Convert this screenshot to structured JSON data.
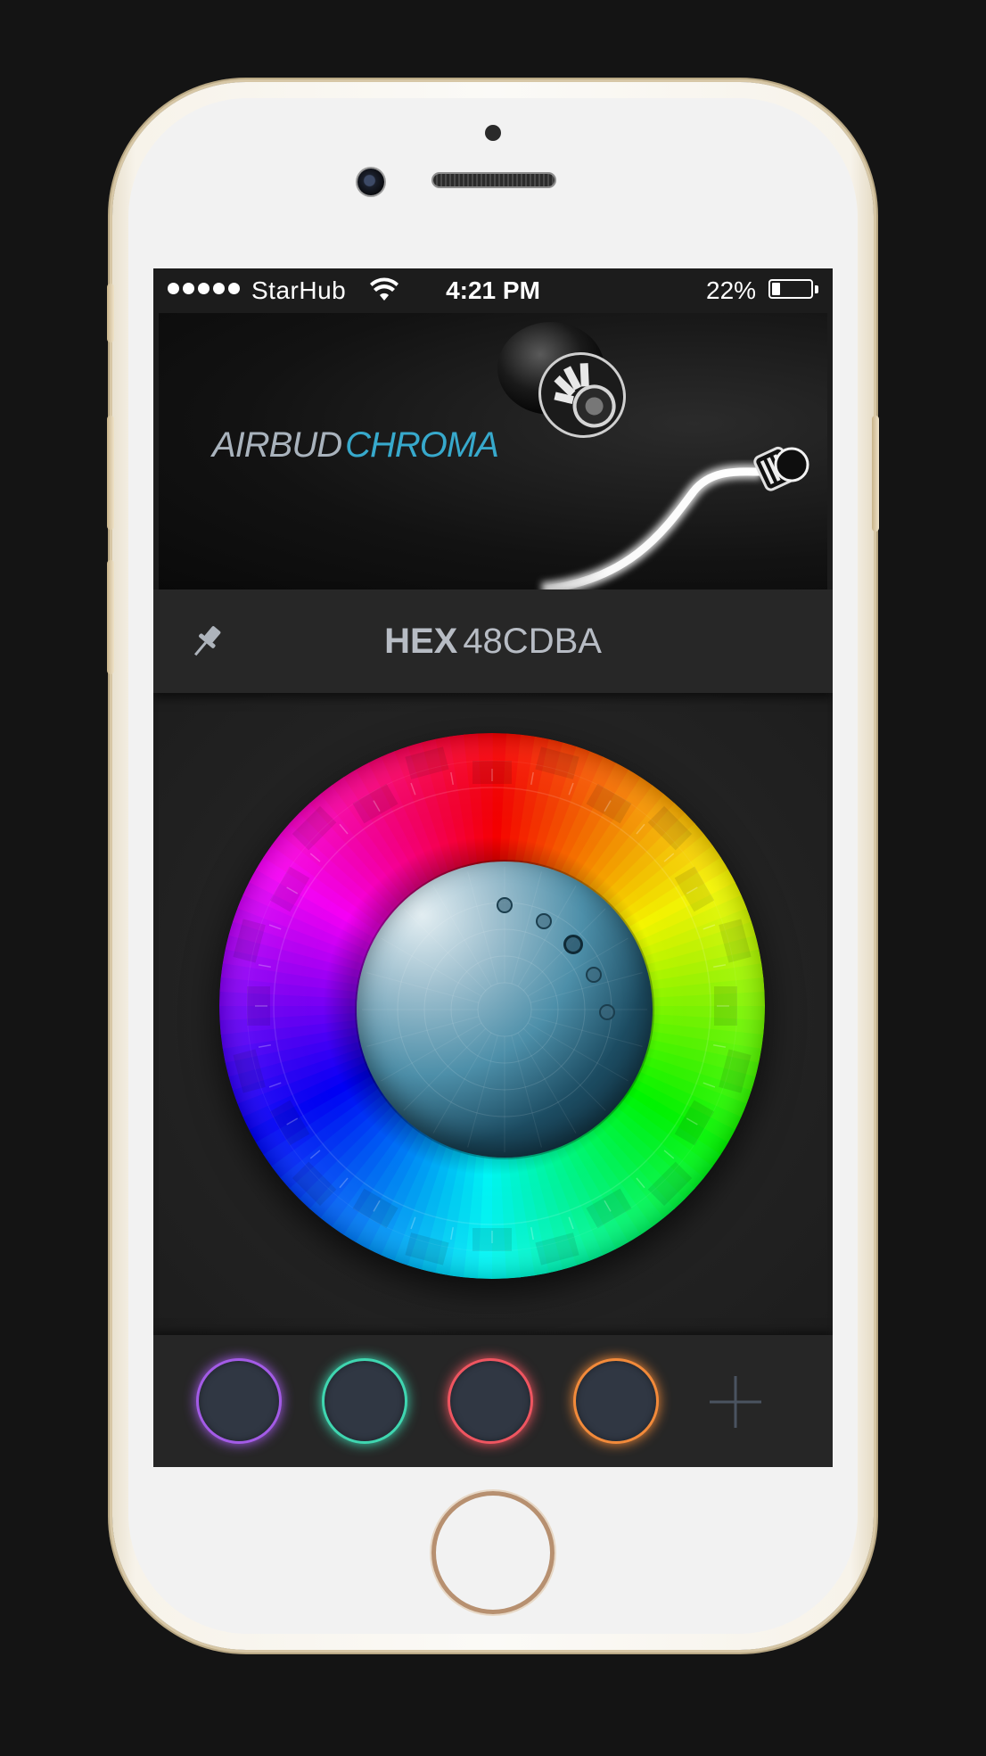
{
  "status_bar": {
    "carrier": "StarHub",
    "time": "4:21 PM",
    "battery_percent": "22%",
    "battery_level": 0.22,
    "signal_dots": 5,
    "icons": [
      "signal-dots-icon",
      "wifi-icon",
      "battery-icon"
    ]
  },
  "banner": {
    "brand_word1": "AIRBUD",
    "brand_word2": "CHROMA"
  },
  "hex_bar": {
    "label": "HEX",
    "value": "48CDBA",
    "pin_icon": "pin-icon"
  },
  "color_wheel": {
    "hue_ring": [
      "#ff0000",
      "#ff7a00",
      "#ffc400",
      "#ffef00",
      "#a6ef00",
      "#19d400",
      "#00b27a",
      "#1f6ed6",
      "#3a10c8",
      "#7a12c2",
      "#c80a88"
    ],
    "center_color": "#48CDBA",
    "selection_handles": 5,
    "selected_handle_index": 2
  },
  "swatches": [
    {
      "name": "purple",
      "ring_color": "#a35be6"
    },
    {
      "name": "teal",
      "ring_color": "#3fd6b0"
    },
    {
      "name": "red",
      "ring_color": "#ef5560"
    },
    {
      "name": "orange",
      "ring_color": "#f28a3a"
    }
  ],
  "add_swatch_icon": "plus-icon"
}
